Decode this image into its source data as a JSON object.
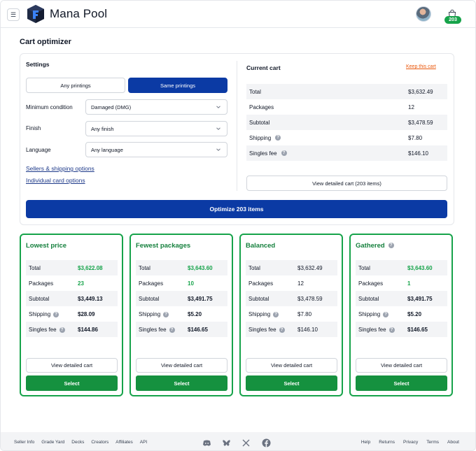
{
  "header": {
    "brand": "Mana Pool",
    "cart_count": "203"
  },
  "page": {
    "title": "Cart optimizer"
  },
  "settings": {
    "title": "Settings",
    "printings": {
      "any_label": "Any printings",
      "same_label": "Same printings",
      "selected": "Same printings"
    },
    "minimum_condition": {
      "label": "Minimum condition",
      "value": "Damaged (DMG)"
    },
    "finish": {
      "label": "Finish",
      "value": "Any finish"
    },
    "language": {
      "label": "Language",
      "value": "Any language"
    },
    "sellers_link": "Sellers & shipping options",
    "individual_link": "Individual card options"
  },
  "current_cart": {
    "title": "Current cart",
    "keep_label": "Keep this cart",
    "rows": [
      {
        "label": "Total",
        "value": "$3,632.49"
      },
      {
        "label": "Packages",
        "value": "12"
      },
      {
        "label": "Subtotal",
        "value": "$3,478.59"
      },
      {
        "label": "Shipping",
        "value": "$7.80"
      },
      {
        "label": "Singles fee",
        "value": "$146.10"
      }
    ],
    "view_label": "View detailed cart (203 items)"
  },
  "optimize_label": "Optimize 203 items",
  "options": [
    {
      "title": "Lowest price",
      "total": "$3,622.08",
      "packages": "23",
      "subtotal": "$3,449.13",
      "shipping": "$28.09",
      "singles_fee": "$144.86",
      "view_label": "View detailed cart",
      "select_label": "Select"
    },
    {
      "title": "Fewest packages",
      "total": "$3,643.60",
      "packages": "10",
      "subtotal": "$3,491.75",
      "shipping": "$5.20",
      "singles_fee": "$146.65",
      "view_label": "View detailed cart",
      "select_label": "Select"
    },
    {
      "title": "Balanced",
      "total": "$3,632.49",
      "packages": "12",
      "subtotal": "$3,478.59",
      "shipping": "$7.80",
      "singles_fee": "$146.10",
      "view_label": "View detailed cart",
      "select_label": "Select"
    },
    {
      "title": "Gathered",
      "total": "$3,643.60",
      "packages": "1",
      "subtotal": "$3,491.75",
      "shipping": "$5.20",
      "singles_fee": "$146.65",
      "view_label": "View detailed cart",
      "select_label": "Select"
    }
  ],
  "row_labels": {
    "total": "Total",
    "packages": "Packages",
    "subtotal": "Subtotal",
    "shipping": "Shipping",
    "singles_fee": "Singles fee"
  },
  "footer": {
    "left_links": [
      "Seller Info",
      "Grade Yard",
      "Decks",
      "Creators",
      "Affiliates",
      "API"
    ],
    "right_links": [
      "Help",
      "Returns",
      "Privacy",
      "Terms",
      "About"
    ],
    "social_icons": [
      "discord-icon",
      "bluesky-icon",
      "x-icon",
      "facebook-icon"
    ]
  },
  "colors": {
    "primary_blue": "#0b3aa4",
    "green": "#16a34a",
    "orange_link": "#ea580c"
  }
}
